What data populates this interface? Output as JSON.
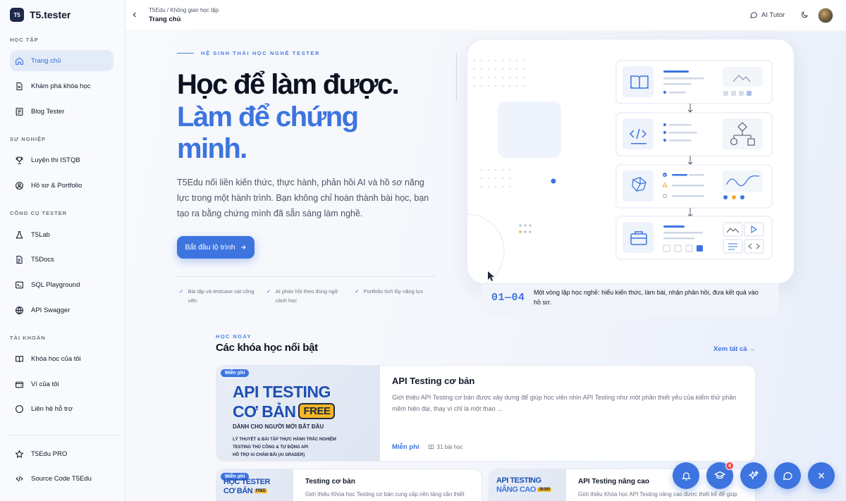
{
  "app": {
    "logo_mark": "T5",
    "name": "T5.tester"
  },
  "sidebar": {
    "sections": [
      {
        "label": "HỌC TẬP"
      },
      {
        "label": "SỰ NGHIỆP"
      },
      {
        "label": "CÔNG CỤ TESTER"
      },
      {
        "label": "TÀI KHOẢN"
      }
    ],
    "items": [
      {
        "label": "Trang chủ",
        "icon": "home-icon",
        "active": true
      },
      {
        "label": "Khám phá khóa học",
        "icon": "document-icon"
      },
      {
        "label": "Blog Tester",
        "icon": "newspaper-icon"
      },
      {
        "label": "Luyện thi ISTQB",
        "icon": "trophy-icon"
      },
      {
        "label": "Hồ sơ & Portfolio",
        "icon": "user-circle-icon"
      },
      {
        "label": "T5Lab",
        "icon": "flask-icon"
      },
      {
        "label": "T5Docs",
        "icon": "docs-icon"
      },
      {
        "label": "SQL Playground",
        "icon": "terminal-icon"
      },
      {
        "label": "API Swagger",
        "icon": "globe-icon"
      },
      {
        "label": "Khóa học của tôi",
        "icon": "book-icon"
      },
      {
        "label": "Ví của tôi",
        "icon": "wallet-icon"
      },
      {
        "label": "Liên hệ hỗ trợ",
        "icon": "chat-icon"
      }
    ],
    "footer_items": [
      {
        "label": "T5Edu PRO",
        "icon": "star-icon"
      },
      {
        "label": "Source Code T5Edu",
        "icon": "code-icon"
      }
    ]
  },
  "header": {
    "breadcrumb": "T5Edu / Không gian học tập",
    "title": "Trang chủ",
    "ai_tutor": "AI Tutor"
  },
  "hero": {
    "eyebrow": "HỆ SINH THÁI HỌC NGHỀ TESTER",
    "title_line1": "Học để làm được.",
    "title_line2": "Làm để chứng minh.",
    "description": "T5Edu nối liền kiến thức, thực hành, phản hồi AI và hồ sơ năng lực trong một hành trình. Bạn không chỉ hoàn thành bài học, bạn tạo ra bằng chứng mình đã sẵn sàng làm nghề.",
    "cta": "Bắt đầu lộ trình",
    "features": [
      "Bài tập và testcase sát công việc",
      "AI phản hồi theo đúng ngữ cảnh học",
      "Portfolio tích lũy năng lực"
    ],
    "step_number": "01—04",
    "step_text": "Một vòng lặp học nghề: hiểu kiến thức, làm bài, nhận phản hồi, đưa kết quả vào hồ sơ."
  },
  "courses": {
    "eyebrow": "HỌC NGAY",
    "title": "Các khóa học nổi bật",
    "see_all": "Xem tất cả",
    "featured": {
      "badge": "Miễn phí",
      "thumb_line1": "API TESTING",
      "thumb_line2": "CƠ BẢN",
      "thumb_free": "FREE",
      "thumb_sub": "DÀNH CHO NGƯỜI MỚI BẮT ĐẦU",
      "thumb_points": [
        "LÝ THUYẾT & BÀI TẬP THỰC HÀNH TRẮC NGHIỆM",
        "TESTING THỦ CÔNG & TỰ ĐỘNG API",
        "HỖ TRỢ AI CHẤM BÀI (AI GRADER)"
      ],
      "title": "API Testing cơ bản",
      "description": "Giới thiệu API Testing cơ bản được xây dựng để giúp học viên nhìn API Testing như một phần thiết yếu của kiểm thử phần mềm hiện đại, thay vì chỉ là một thao ...",
      "price": "Miễn phí",
      "lessons": "31 bài học"
    },
    "others": [
      {
        "badge": "Miễn phí",
        "thumb_line1": "HỌC TESTER",
        "thumb_line2": "CƠ BẢN",
        "thumb_tag": "FREE",
        "title": "Testing cơ bản",
        "description": "Giới thiệu Khóa học Testing cơ bản cung cấp nền tảng cần thiết"
      },
      {
        "badge": "",
        "thumb_line1": "API TESTING",
        "thumb_line2": "NÂNG CAO",
        "thumb_tag": "39.000",
        "title": "API Testing nâng cao",
        "description": "Giới thiệu Khóa học API Testing nâng cao được thiết kế để giúp"
      }
    ]
  },
  "fab": {
    "notification_count": "4"
  },
  "colors": {
    "accent": "#3d74df",
    "dark_text": "#0b1220",
    "free_badge": "#f5b623"
  }
}
